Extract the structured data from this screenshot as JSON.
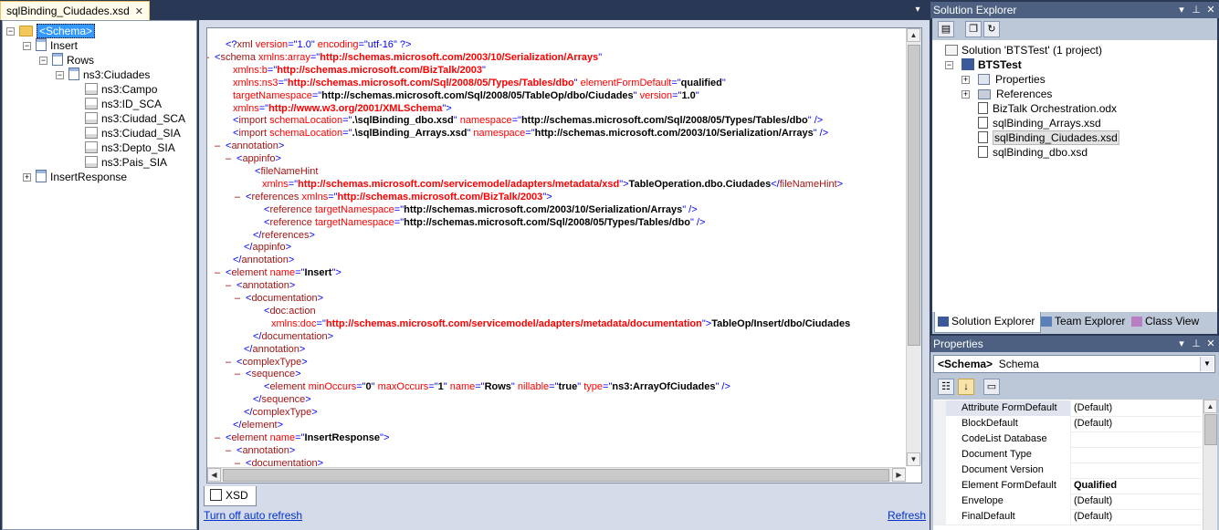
{
  "editor": {
    "tab_label": "sqlBinding_Ciudades.xsd",
    "tab_close": "✕",
    "dropdown": "▾"
  },
  "schema_tree": [
    {
      "label": "<Schema>",
      "expander": "⊟"
    },
    {
      "label": "Insert",
      "expander": "⊟"
    },
    {
      "label": "Rows",
      "expander": "⊟"
    },
    {
      "label": "ns3:Ciudades",
      "expander": "⊟"
    },
    {
      "label": "ns3:Campo"
    },
    {
      "label": "ns3:ID_SCA"
    },
    {
      "label": "ns3:Ciudad_SCA"
    },
    {
      "label": "ns3:Ciudad_SIA"
    },
    {
      "label": "ns3:Depto_SIA"
    },
    {
      "label": "ns3:Pais_SIA"
    },
    {
      "label": "InsertResponse",
      "expander": "⊞"
    }
  ],
  "code_lines": [
    {
      "marker": "",
      "parts": [
        [
          "bl",
          "<?"
        ],
        [
          "nm",
          "xml "
        ],
        [
          "at",
          "version"
        ],
        [
          "bl",
          "=\""
        ],
        [
          "bl",
          "1.0"
        ],
        [
          "bl",
          "\" "
        ],
        [
          "at",
          "encoding"
        ],
        [
          "bl",
          "=\""
        ],
        [
          "bl",
          "utf-16"
        ],
        [
          "bl",
          "\" ?>"
        ]
      ]
    },
    {
      "marker": "–",
      "parts": [
        [
          "bl",
          "<"
        ],
        [
          "nm",
          "schema "
        ],
        [
          "at",
          "xmlns:array"
        ],
        [
          "bl",
          "=\""
        ],
        [
          "avr",
          "http://schemas.microsoft.com/2003/10/Serialization/Arrays"
        ],
        [
          "bl",
          "\""
        ]
      ]
    },
    {
      "marker": "",
      "parts": [
        [
          "at",
          "xmlns:b"
        ],
        [
          "bl",
          "=\""
        ],
        [
          "avr",
          "http://schemas.microsoft.com/BizTalk/2003"
        ],
        [
          "bl",
          "\""
        ]
      ]
    },
    {
      "marker": "",
      "parts": [
        [
          "at",
          "xmlns:ns3"
        ],
        [
          "bl",
          "=\""
        ],
        [
          "avr",
          "http://schemas.microsoft.com/Sql/2008/05/Types/Tables/dbo"
        ],
        [
          "bl",
          "\" "
        ],
        [
          "at",
          "elementFormDefault"
        ],
        [
          "bl",
          "=\""
        ],
        [
          "bold",
          "qualified"
        ],
        [
          "bl",
          "\""
        ]
      ]
    },
    {
      "marker": "",
      "parts": [
        [
          "at",
          "targetNamespace"
        ],
        [
          "bl",
          "=\""
        ],
        [
          "bold",
          "http://schemas.microsoft.com/Sql/2008/05/TableOp/dbo/Ciudades"
        ],
        [
          "bl",
          "\" "
        ],
        [
          "at",
          "version"
        ],
        [
          "bl",
          "=\""
        ],
        [
          "bold",
          "1.0"
        ],
        [
          "bl",
          "\""
        ]
      ]
    },
    {
      "marker": "",
      "parts": [
        [
          "at",
          "xmlns"
        ],
        [
          "bl",
          "=\""
        ],
        [
          "avr",
          "http://www.w3.org/2001/XMLSchema"
        ],
        [
          "bl",
          "\">"
        ]
      ]
    },
    {
      "marker": "",
      "parts": [
        [
          "bl",
          "<"
        ],
        [
          "nm",
          "import "
        ],
        [
          "at",
          "schemaLocation"
        ],
        [
          "bl",
          "=\""
        ],
        [
          "bold",
          ".\\sqlBinding_dbo.xsd"
        ],
        [
          "bl",
          "\" "
        ],
        [
          "at",
          "namespace"
        ],
        [
          "bl",
          "=\""
        ],
        [
          "bold",
          "http://schemas.microsoft.com/Sql/2008/05/Types/Tables/dbo"
        ],
        [
          "bl",
          "\" />"
        ]
      ]
    },
    {
      "marker": "",
      "parts": [
        [
          "bl",
          "<"
        ],
        [
          "nm",
          "import "
        ],
        [
          "at",
          "schemaLocation"
        ],
        [
          "bl",
          "=\""
        ],
        [
          "bold",
          ".\\sqlBinding_Arrays.xsd"
        ],
        [
          "bl",
          "\" "
        ],
        [
          "at",
          "namespace"
        ],
        [
          "bl",
          "=\""
        ],
        [
          "bold",
          "http://schemas.microsoft.com/2003/10/Serialization/Arrays"
        ],
        [
          "bl",
          "\" />"
        ]
      ]
    },
    {
      "marker": "–",
      "parts": [
        [
          "bl",
          "<"
        ],
        [
          "nm",
          "annotation"
        ],
        [
          "bl",
          ">"
        ]
      ]
    },
    {
      "marker": "–",
      "parts": [
        [
          "bl",
          "<"
        ],
        [
          "nm",
          "appinfo"
        ],
        [
          "bl",
          ">"
        ]
      ]
    },
    {
      "marker": "",
      "parts": [
        [
          "bl",
          "<"
        ],
        [
          "nm",
          "fileNameHint"
        ]
      ]
    },
    {
      "marker": "",
      "parts": [
        [
          "at",
          "xmlns"
        ],
        [
          "bl",
          "=\""
        ],
        [
          "avr",
          "http://schemas.microsoft.com/servicemodel/adapters/metadata/xsd"
        ],
        [
          "bl",
          "\">"
        ],
        [
          "bold",
          "TableOperation.dbo.Ciudades"
        ],
        [
          "bl",
          "</"
        ],
        [
          "nm",
          "fileNameHint"
        ],
        [
          "bl",
          ">"
        ]
      ]
    },
    {
      "marker": "–",
      "parts": [
        [
          "bl",
          "<"
        ],
        [
          "nm",
          "references "
        ],
        [
          "at",
          "xmlns"
        ],
        [
          "bl",
          "=\""
        ],
        [
          "avr",
          "http://schemas.microsoft.com/BizTalk/2003"
        ],
        [
          "bl",
          "\">"
        ]
      ]
    },
    {
      "marker": "",
      "parts": [
        [
          "bl",
          "<"
        ],
        [
          "nm",
          "reference "
        ],
        [
          "at",
          "targetNamespace"
        ],
        [
          "bl",
          "=\""
        ],
        [
          "bold",
          "http://schemas.microsoft.com/2003/10/Serialization/Arrays"
        ],
        [
          "bl",
          "\" />"
        ]
      ]
    },
    {
      "marker": "",
      "parts": [
        [
          "bl",
          "<"
        ],
        [
          "nm",
          "reference "
        ],
        [
          "at",
          "targetNamespace"
        ],
        [
          "bl",
          "=\""
        ],
        [
          "bold",
          "http://schemas.microsoft.com/Sql/2008/05/Types/Tables/dbo"
        ],
        [
          "bl",
          "\" />"
        ]
      ]
    },
    {
      "marker": "",
      "parts": [
        [
          "bl",
          "</"
        ],
        [
          "nm",
          "references"
        ],
        [
          "bl",
          ">"
        ]
      ]
    },
    {
      "marker": "",
      "parts": [
        [
          "bl",
          "</"
        ],
        [
          "nm",
          "appinfo"
        ],
        [
          "bl",
          ">"
        ]
      ]
    },
    {
      "marker": "",
      "parts": [
        [
          "bl",
          "</"
        ],
        [
          "nm",
          "annotation"
        ],
        [
          "bl",
          ">"
        ]
      ]
    },
    {
      "marker": "–",
      "parts": [
        [
          "bl",
          "<"
        ],
        [
          "nm",
          "element "
        ],
        [
          "at",
          "name"
        ],
        [
          "bl",
          "=\""
        ],
        [
          "bold",
          "Insert"
        ],
        [
          "bl",
          "\">"
        ]
      ]
    },
    {
      "marker": "–",
      "parts": [
        [
          "bl",
          "<"
        ],
        [
          "nm",
          "annotation"
        ],
        [
          "bl",
          ">"
        ]
      ]
    },
    {
      "marker": "–",
      "parts": [
        [
          "bl",
          "<"
        ],
        [
          "nm",
          "documentation"
        ],
        [
          "bl",
          ">"
        ]
      ]
    },
    {
      "marker": "",
      "parts": [
        [
          "bl",
          "<"
        ],
        [
          "nm",
          "doc:action"
        ]
      ]
    },
    {
      "marker": "",
      "parts": [
        [
          "at",
          "xmlns:doc"
        ],
        [
          "bl",
          "=\""
        ],
        [
          "avr",
          "http://schemas.microsoft.com/servicemodel/adapters/metadata/documentation"
        ],
        [
          "bl",
          "\">"
        ],
        [
          "bold",
          "TableOp/Insert/dbo/Ciudades"
        ]
      ]
    },
    {
      "marker": "",
      "parts": [
        [
          "bl",
          "</"
        ],
        [
          "nm",
          "documentation"
        ],
        [
          "bl",
          ">"
        ]
      ]
    },
    {
      "marker": "",
      "parts": [
        [
          "bl",
          "</"
        ],
        [
          "nm",
          "annotation"
        ],
        [
          "bl",
          ">"
        ]
      ]
    },
    {
      "marker": "–",
      "parts": [
        [
          "bl",
          "<"
        ],
        [
          "nm",
          "complexType"
        ],
        [
          "bl",
          ">"
        ]
      ]
    },
    {
      "marker": "–",
      "parts": [
        [
          "bl",
          "<"
        ],
        [
          "nm",
          "sequence"
        ],
        [
          "bl",
          ">"
        ]
      ]
    },
    {
      "marker": "",
      "parts": [
        [
          "bl",
          "<"
        ],
        [
          "nm",
          "element "
        ],
        [
          "at",
          "minOccurs"
        ],
        [
          "bl",
          "=\""
        ],
        [
          "bold",
          "0"
        ],
        [
          "bl",
          "\" "
        ],
        [
          "at",
          "maxOccurs"
        ],
        [
          "bl",
          "=\""
        ],
        [
          "bold",
          "1"
        ],
        [
          "bl",
          "\" "
        ],
        [
          "at",
          "name"
        ],
        [
          "bl",
          "=\""
        ],
        [
          "bold",
          "Rows"
        ],
        [
          "bl",
          "\" "
        ],
        [
          "at",
          "nillable"
        ],
        [
          "bl",
          "=\""
        ],
        [
          "bold",
          "true"
        ],
        [
          "bl",
          "\" "
        ],
        [
          "at",
          "type"
        ],
        [
          "bl",
          "=\""
        ],
        [
          "bold",
          "ns3:ArrayOfCiudades"
        ],
        [
          "bl",
          "\" />"
        ]
      ]
    },
    {
      "marker": "",
      "parts": [
        [
          "bl",
          "</"
        ],
        [
          "nm",
          "sequence"
        ],
        [
          "bl",
          ">"
        ]
      ]
    },
    {
      "marker": "",
      "parts": [
        [
          "bl",
          "</"
        ],
        [
          "nm",
          "complexType"
        ],
        [
          "bl",
          ">"
        ]
      ]
    },
    {
      "marker": "",
      "parts": [
        [
          "bl",
          "</"
        ],
        [
          "nm",
          "element"
        ],
        [
          "bl",
          ">"
        ]
      ]
    },
    {
      "marker": "–",
      "parts": [
        [
          "bl",
          "<"
        ],
        [
          "nm",
          "element "
        ],
        [
          "at",
          "name"
        ],
        [
          "bl",
          "=\""
        ],
        [
          "bold",
          "InsertResponse"
        ],
        [
          "bl",
          "\">"
        ]
      ]
    },
    {
      "marker": "–",
      "parts": [
        [
          "bl",
          "<"
        ],
        [
          "nm",
          "annotation"
        ],
        [
          "bl",
          ">"
        ]
      ]
    },
    {
      "marker": "–",
      "parts": [
        [
          "bl",
          "<"
        ],
        [
          "nm",
          "documentation"
        ],
        [
          "bl",
          ">"
        ]
      ]
    }
  ],
  "bottom": {
    "xsd_tab": "XSD",
    "auto_refresh_link": "Turn off auto refresh",
    "refresh_link": "Refresh"
  },
  "solution_explorer": {
    "title": "Solution Explorer",
    "title_buttons": [
      "▾",
      "📌",
      "✕"
    ],
    "items": [
      {
        "label": "Solution 'BTSTest' (1 project)"
      },
      {
        "label": "BTSTest",
        "expander": "⊟"
      },
      {
        "label": "Properties",
        "expander": "⊞"
      },
      {
        "label": "References",
        "expander": "⊞"
      },
      {
        "label": "BizTalk Orchestration.odx"
      },
      {
        "label": "sqlBinding_Arrays.xsd"
      },
      {
        "label": "sqlBinding_Ciudades.xsd"
      },
      {
        "label": "sqlBinding_dbo.xsd"
      }
    ],
    "tabs": [
      "Solution Explorer",
      "Team Explorer",
      "Class View"
    ]
  },
  "properties": {
    "title": "Properties",
    "object_name": "<Schema>",
    "object_type": "Schema",
    "rows": [
      {
        "name": "Attribute FormDefault",
        "value": "(Default)"
      },
      {
        "name": "BlockDefault",
        "value": "(Default)"
      },
      {
        "name": "CodeList Database",
        "value": ""
      },
      {
        "name": "Document Type",
        "value": ""
      },
      {
        "name": "Document Version",
        "value": ""
      },
      {
        "name": "Element FormDefault",
        "value": "Qualified"
      },
      {
        "name": "Envelope",
        "value": "(Default)"
      },
      {
        "name": "FinalDefault",
        "value": "(Default)"
      }
    ]
  },
  "colors": {
    "chrome": "#293955",
    "tab_active": "#fffceb",
    "panel_title": "#4d6082",
    "selection": "#3399ff"
  }
}
